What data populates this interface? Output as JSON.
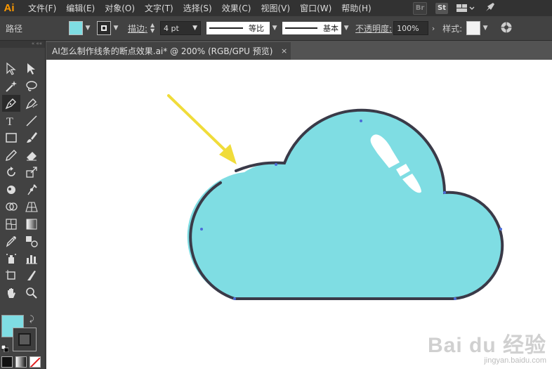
{
  "app": {
    "logo": "Ai"
  },
  "menu": [
    "文件(F)",
    "编辑(E)",
    "对象(O)",
    "文字(T)",
    "选择(S)",
    "效果(C)",
    "视图(V)",
    "窗口(W)",
    "帮助(H)"
  ],
  "menu_right": {
    "br_label": "Br",
    "st_label": "St"
  },
  "control_bar": {
    "selection_label": "路径",
    "fill_color": "#7fdde3",
    "stroke_label": "描边:",
    "stroke_weight": "4 pt",
    "stroke_profile_label": "等比",
    "brush_label": "基本",
    "opacity_label": "不透明度:",
    "opacity_value": "100%",
    "style_label": "样式:"
  },
  "document_tab": {
    "title": "AI怎么制作线条的断点效果.ai* @ 200% (RGB/GPU 预览)",
    "close": "×"
  },
  "tools": [
    "selection-tool",
    "direct-selection-tool",
    "magic-wand-tool",
    "lasso-tool",
    "pen-tool",
    "curvature-tool",
    "type-tool",
    "line-tool",
    "rectangle-tool",
    "paintbrush-tool",
    "pencil-tool",
    "eraser-tool",
    "rotate-tool",
    "scale-tool",
    "warp-tool",
    "puppet-warp-tool",
    "shape-builder-tool",
    "perspective-grid-tool",
    "mesh-tool",
    "gradient-tool",
    "eyedropper-tool",
    "blend-tool",
    "symbol-sprayer-tool",
    "graph-tool",
    "artboard-tool",
    "slice-tool",
    "hand-tool",
    "zoom-tool"
  ],
  "colors": {
    "fill": "#7fdde3",
    "stroke": "#3a3a48",
    "arrow": "#f0dc3a",
    "accent": "#ff9a00"
  },
  "watermark": {
    "main": "Bai du 经验",
    "sub": "jingyan.baidu.com"
  }
}
